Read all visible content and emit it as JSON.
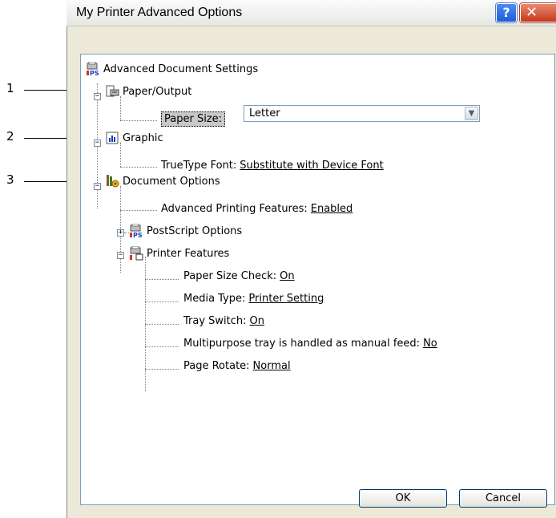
{
  "window": {
    "title": "My Printer Advanced Options",
    "help_symbol": "?",
    "close_symbol": "✕"
  },
  "callouts": [
    "1",
    "2",
    "3"
  ],
  "tree": {
    "root": "Advanced Document Settings",
    "paper_output": {
      "label": "Paper/Output",
      "paper_size_label": "Paper Size:",
      "paper_size_value": "Letter"
    },
    "graphic": {
      "label": "Graphic",
      "truetype_label": "TrueType Font:",
      "truetype_value": "Substitute with Device Font"
    },
    "document_options": {
      "label": "Document Options",
      "advanced_printing_label": "Advanced Printing Features:",
      "advanced_printing_value": "Enabled",
      "postscript_label": "PostScript Options",
      "printer_features": {
        "label": "Printer Features",
        "items": [
          {
            "label": "Paper Size Check:",
            "value": "On"
          },
          {
            "label": "Media Type:",
            "value": "Printer Setting"
          },
          {
            "label": "Tray Switch:",
            "value": "On"
          },
          {
            "label": "Multipurpose tray is handled as manual feed:",
            "value": "No"
          },
          {
            "label": "Page Rotate:",
            "value": "Normal"
          }
        ]
      }
    }
  },
  "buttons": {
    "ok": "OK",
    "cancel": "Cancel"
  }
}
